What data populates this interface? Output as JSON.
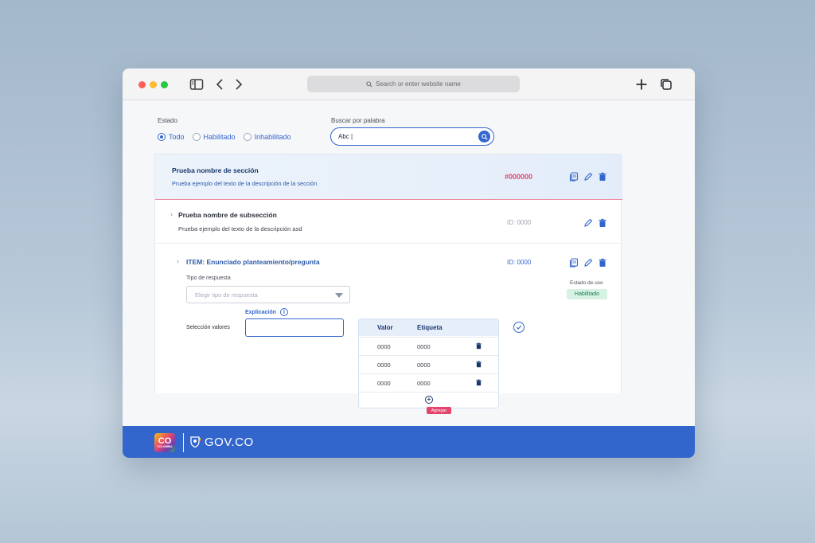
{
  "browser": {
    "address_placeholder": "Search or enter website name",
    "icons": [
      "sidebar-icon",
      "back-icon",
      "forward-icon",
      "new-tab-icon",
      "tabs-overview-icon",
      "search-icon"
    ]
  },
  "filters": {
    "estado_label": "Estado",
    "options": [
      "Todo",
      "Habilitado",
      "Inhabilitado"
    ],
    "selected": "Todo",
    "search_label": "Buscar por palabra",
    "search_value": "Abc |"
  },
  "section": {
    "title": "Prueba nombre de sección",
    "description": "Prueba ejemplo del texto de la descripción de la sección",
    "code": "#000000"
  },
  "subsection": {
    "title": "Prueba nombre de subsección",
    "description": "Prueba ejemplo del texto de la descripción asd",
    "id": "ID: 0000"
  },
  "item": {
    "title": "ITEM: Enunciado planteamiento/pregunta",
    "id": "ID: 0000",
    "tipo_label": "Tipo de respuesta",
    "tipo_placeholder": "Elegir tipo de respuesta",
    "estado_uso_label": "Estado de uso",
    "estado_uso_value": "Habilitado",
    "explicacion_label": "Explicación",
    "seleccion_label": "Selección valores",
    "table": {
      "headers": [
        "Valor",
        "Etiqueta"
      ],
      "rows": [
        [
          "0000",
          "0000"
        ],
        [
          "0000",
          "0000"
        ],
        [
          "0000",
          "0000"
        ]
      ]
    },
    "add_label": "Agregar"
  },
  "footer": {
    "co_text": "CO",
    "co_subtext": "COLOMBIA",
    "gov_text": "GOV.CO"
  },
  "colors": {
    "primary": "#3366cc",
    "accent": "#e4456d",
    "navy": "#17376b",
    "success_bg": "#d6f2e4"
  }
}
